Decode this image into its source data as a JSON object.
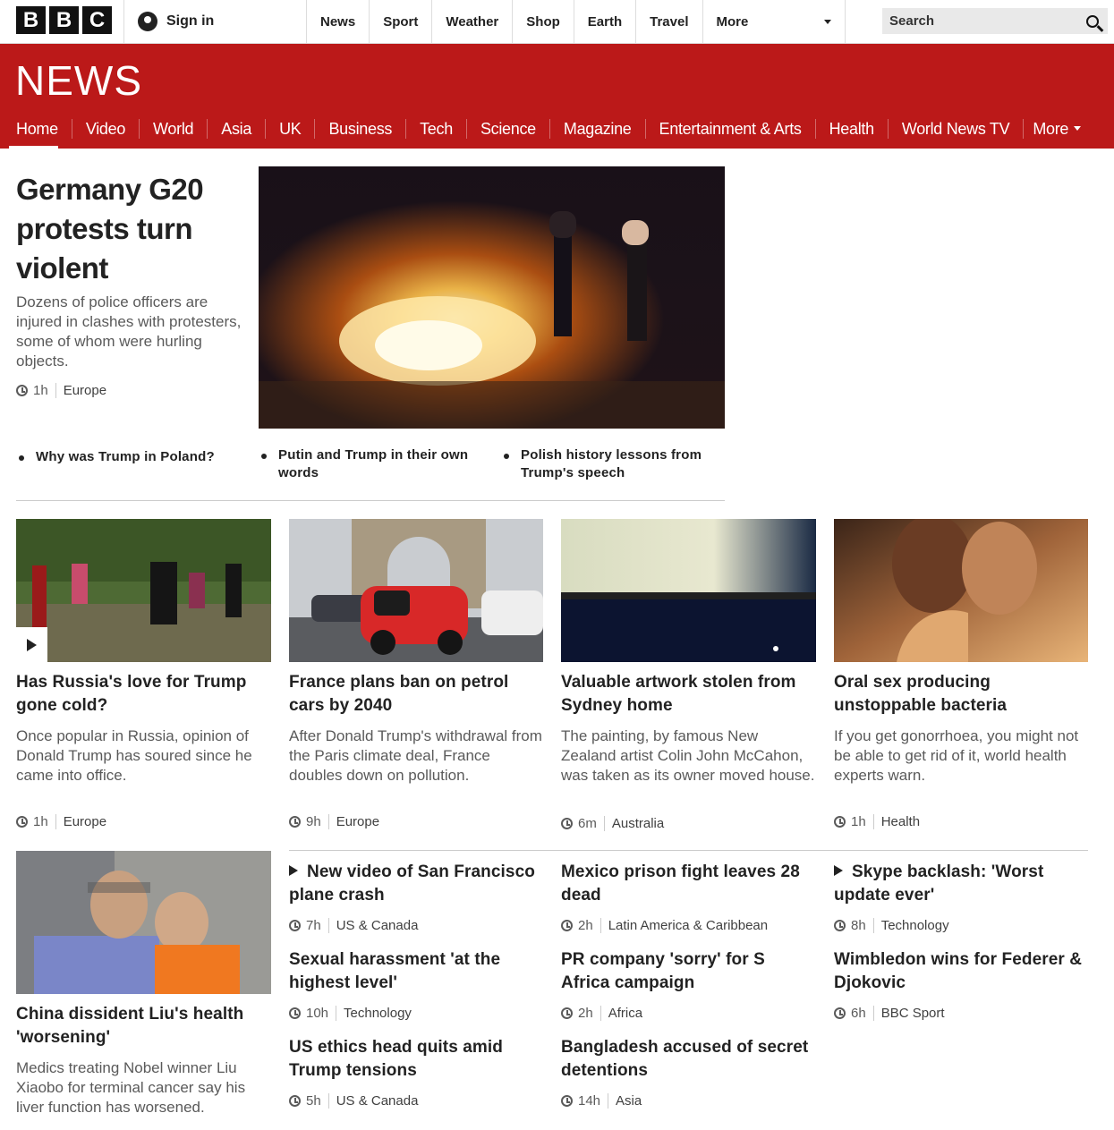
{
  "topbar": {
    "logo_letters": [
      "B",
      "B",
      "C"
    ],
    "sign_in": "Sign in",
    "nav": [
      "News",
      "Sport",
      "Weather",
      "Shop",
      "Earth",
      "Travel"
    ],
    "more": "More",
    "search_placeholder": "Search"
  },
  "header": {
    "logo": "NEWS",
    "sections": [
      "Home",
      "Video",
      "World",
      "Asia",
      "UK",
      "Business",
      "Tech",
      "Science",
      "Magazine",
      "Entertainment & Arts",
      "Health",
      "World News TV"
    ],
    "more": "More",
    "active": "Home"
  },
  "lead": {
    "title": "Germany G20 protests turn violent",
    "summary": "Dozens of police officers are injured in clashes with protesters, some of whom were hurling objects.",
    "time": "1h",
    "section": "Europe",
    "related": [
      "Why was Trump in Poland?",
      "Putin and Trump in their own words",
      "Polish history lessons from Trump's speech"
    ]
  },
  "cards": [
    {
      "title": "Has Russia's love for Trump gone cold?",
      "summary": "Once popular in Russia, opinion of Donald Trump has soured since he came into office.",
      "time": "1h",
      "section": "Europe",
      "video": true
    },
    {
      "title": "France plans ban on petrol cars by 2040",
      "summary": "After Donald Trump's withdrawal from the Paris climate deal, France doubles down on pollution.",
      "time": "9h",
      "section": "Europe"
    },
    {
      "title": "Valuable artwork stolen from Sydney home",
      "summary": "The painting, by famous New Zealand artist Colin John McCahon, was taken as its owner moved house.",
      "time": "6m",
      "section": "Australia"
    },
    {
      "title": "Oral sex producing unstoppable bacteria",
      "summary": "If you get gonorrhoea, you might not be able to get rid of it, world health experts warn.",
      "time": "1h",
      "section": "Health"
    }
  ],
  "feature": {
    "title": "China dissident Liu's health 'worsening'",
    "summary": "Medics treating Nobel winner Liu Xiaobo for terminal cancer say his liver function has worsened."
  },
  "headlines": [
    {
      "title": "New video of San Francisco plane crash",
      "time": "7h",
      "section": "US & Canada",
      "video": true
    },
    {
      "title": "Mexico prison fight leaves 28 dead",
      "time": "2h",
      "section": "Latin America & Caribbean"
    },
    {
      "title": "Skype backlash: 'Worst update ever'",
      "time": "8h",
      "section": "Technology",
      "video": true
    },
    {
      "title": "Sexual harassment 'at the highest level'",
      "time": "10h",
      "section": "Technology"
    },
    {
      "title": "PR company 'sorry' for S Africa campaign",
      "time": "2h",
      "section": "Africa"
    },
    {
      "title": "Wimbledon wins for Federer & Djokovic",
      "time": "6h",
      "section": "BBC Sport"
    },
    {
      "title": "US ethics head quits amid Trump tensions",
      "time": "5h",
      "section": "US & Canada"
    },
    {
      "title": "Bangladesh accused of secret detentions",
      "time": "14h",
      "section": "Asia"
    }
  ],
  "colors": {
    "brand_red": "#bb1919",
    "text": "#222222",
    "summary": "#5a5a5a"
  }
}
